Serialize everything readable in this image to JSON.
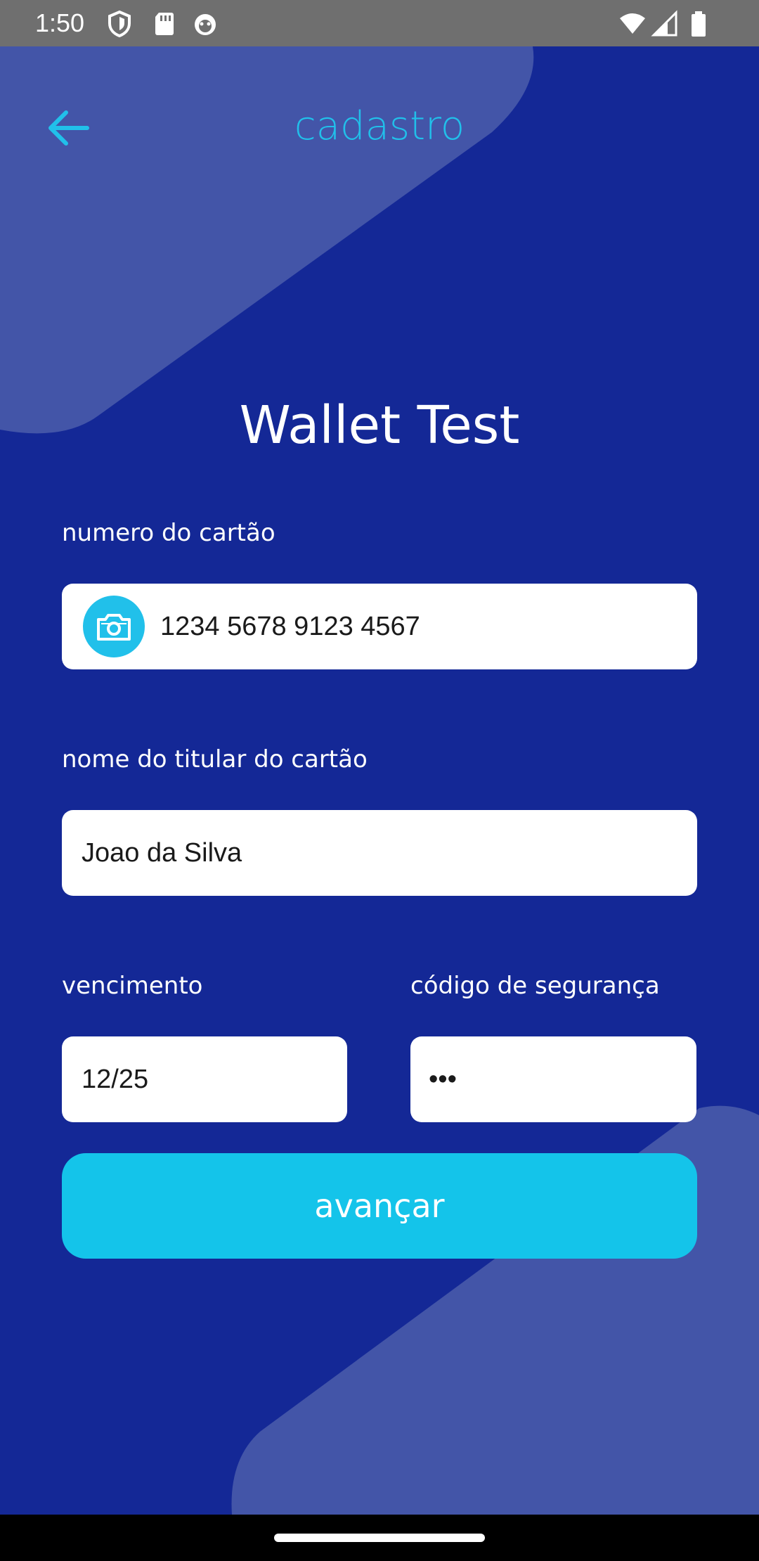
{
  "status_bar": {
    "time": "1:50",
    "left_icons": [
      "shield-icon",
      "sd-card-icon",
      "android-icon"
    ],
    "right_icons": [
      "wifi-icon",
      "signal-icon",
      "battery-icon"
    ]
  },
  "header": {
    "title": "cadastro",
    "back_icon": "arrow-left-icon"
  },
  "app_title": "Wallet Test",
  "form": {
    "card_number": {
      "label": "numero do cartão",
      "value": "1234 5678 9123 4567",
      "icon": "camera-icon"
    },
    "holder_name": {
      "label": "nome do titular do cartão",
      "value": "Joao da Silva"
    },
    "expiry": {
      "label": "vencimento",
      "value": "12/25"
    },
    "security_code": {
      "label": "código de segurança",
      "value": "•••"
    },
    "submit_label": "avançar"
  },
  "colors": {
    "background": "#142896",
    "shape": "#4355a8",
    "accent": "#14c4ea",
    "header_title": "#21c0ea"
  }
}
